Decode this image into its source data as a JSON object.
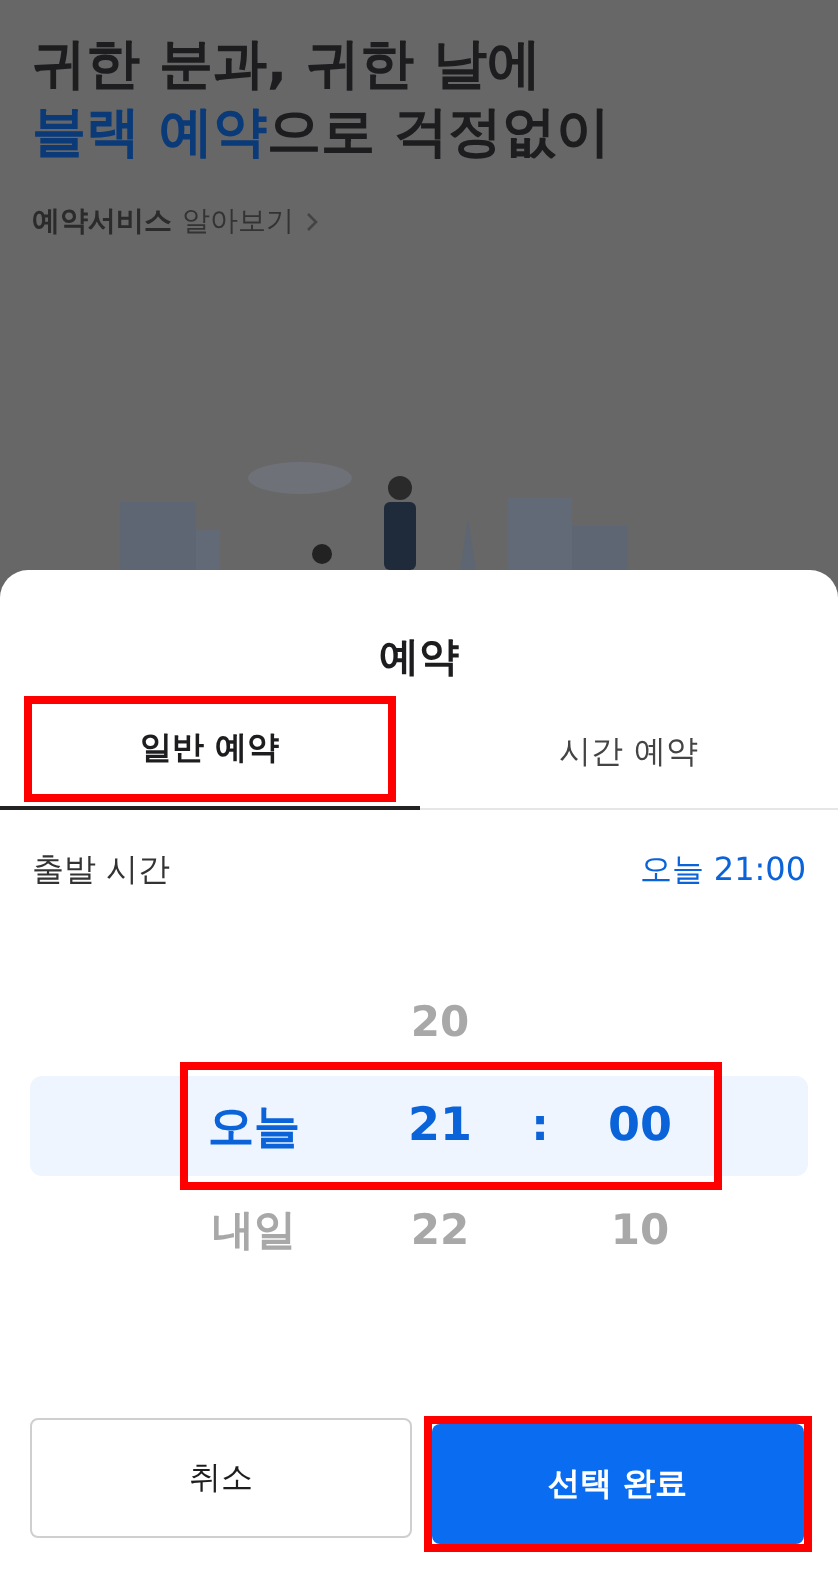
{
  "background": {
    "headline": [
      [
        {
          "text": "귀한 분과, 귀한 날에",
          "accent": false
        }
      ],
      [
        {
          "text": "블랙 예약",
          "accent": true
        },
        {
          "text": "으로 걱정없이",
          "accent": false
        }
      ]
    ],
    "link": {
      "bold": "예약서비스",
      "text": "알아보기"
    },
    "illustration": {
      "kind": "picture"
    }
  },
  "sheet": {
    "title": "예약",
    "tabs": [
      {
        "label": "일반 예약",
        "selected": true,
        "highlighted": true
      },
      {
        "label": "시간 예약",
        "selected": false,
        "highlighted": false
      }
    ],
    "departure": {
      "label": "출발 시간",
      "value": "오늘 21:00"
    },
    "picker": {
      "highlighted": true,
      "separator": ":",
      "columns": [
        {
          "items": [
            {
              "label": "오늘",
              "selected": true
            },
            {
              "label": "내일",
              "selected": false
            }
          ]
        },
        {
          "items": [
            {
              "label": "20",
              "selected": false
            },
            {
              "label": "21",
              "selected": true
            },
            {
              "label": "22",
              "selected": false
            }
          ]
        },
        {
          "items": [
            {
              "label": "00",
              "selected": true
            },
            {
              "label": "10",
              "selected": false
            }
          ]
        }
      ]
    },
    "buttons": [
      {
        "label": "취소",
        "kind": "secondary",
        "highlighted": false
      },
      {
        "label": "선택 완료",
        "kind": "primary",
        "highlighted": true
      }
    ]
  }
}
